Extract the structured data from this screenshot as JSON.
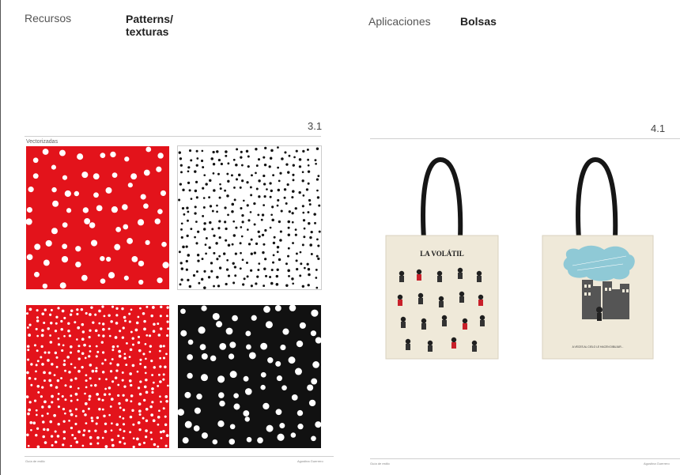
{
  "left": {
    "section": "Recursos",
    "title_line1": "Patterns/",
    "title_line2": "texturas",
    "number": "3.1",
    "caption": "Vectorizadas",
    "footer_left": "Guía de estilo",
    "footer_right": "Agustina Guerrero",
    "patterns": [
      {
        "name": "red-large-dots",
        "bg": "#e3131b",
        "dot": "#ffffff"
      },
      {
        "name": "white-small-dots",
        "bg": "#ffffff",
        "dot": "#111111"
      },
      {
        "name": "red-small-dots",
        "bg": "#e3131b",
        "dot": "#ffffff"
      },
      {
        "name": "black-large-dots",
        "bg": "#111111",
        "dot": "#ffffff"
      }
    ]
  },
  "right": {
    "section": "Aplicaciones",
    "title": "Bolsas",
    "number": "4.1",
    "footer_left": "Guía de estilo",
    "footer_right": "Agustina Guerrero",
    "bag1_brand": "LA VOLÁTIL",
    "bag2_caption": "A VECES AL CIELO LE HACEN DIBUJAR..."
  }
}
